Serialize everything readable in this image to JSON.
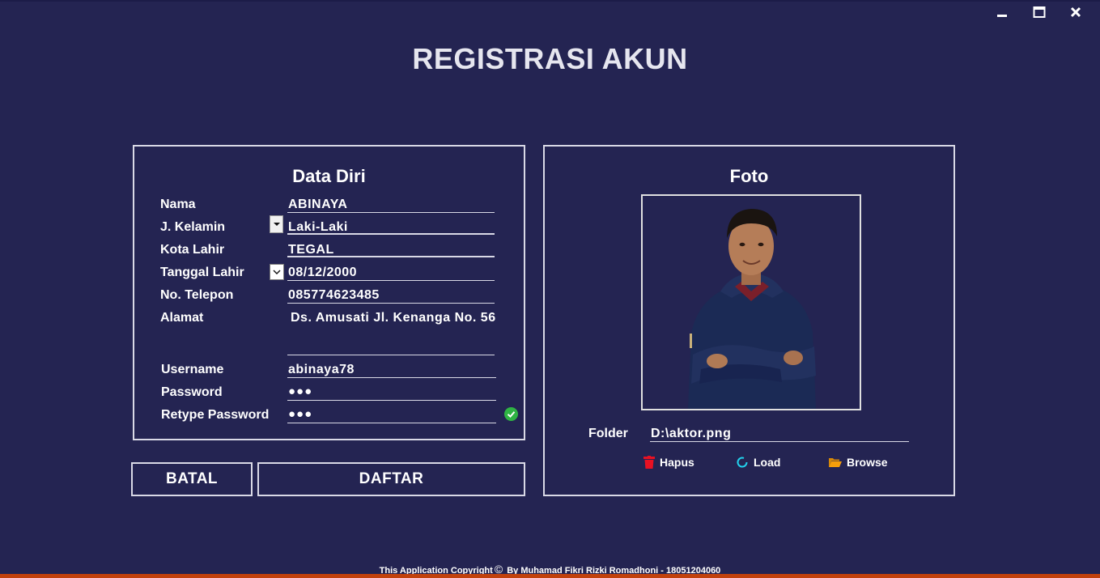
{
  "window": {
    "minimize_icon": "minimize-icon",
    "maximize_icon": "maximize-icon",
    "close_icon": "close-icon"
  },
  "title": "REGISTRASI AKUN",
  "data_diri": {
    "heading": "Data Diri",
    "fields": {
      "nama": {
        "label": "Nama",
        "value": "ABINAYA"
      },
      "kelamin": {
        "label": "J. Kelamin",
        "value": "Laki-Laki"
      },
      "kota_lahir": {
        "label": "Kota Lahir",
        "value": "TEGAL"
      },
      "tanggal_lahir": {
        "label": "Tanggal Lahir",
        "value": "08/12/2000"
      },
      "telepon": {
        "label": "No. Telepon",
        "value": "085774623485"
      },
      "alamat": {
        "label": "Alamat",
        "value": "Ds. Amusati Jl. Kenanga No. 56"
      },
      "username": {
        "label": "Username",
        "value": "abinaya78"
      },
      "password": {
        "label": "Password",
        "value": "●●●"
      },
      "retype": {
        "label": "Retype Password",
        "value": "●●●"
      }
    }
  },
  "foto": {
    "heading": "Foto",
    "folder_label": "Folder",
    "folder_value": "D:\\aktor.png",
    "actions": {
      "hapus": "Hapus",
      "load": "Load",
      "browse": "Browse"
    }
  },
  "buttons": {
    "batal": "BATAL",
    "daftar": "DAFTAR"
  },
  "footer": {
    "pre": "This Application Copyright",
    "symbol": "©",
    "post": " By Muhamad Fikri Rizki Romadhoni - 18051204060"
  },
  "colors": {
    "background": "#242452",
    "border": "#d9d9e6",
    "check": "#2fb344",
    "hapus": "#e81123",
    "load": "#22d3ee",
    "browse": "#f59e0b",
    "accent_bar": "#c2410c"
  }
}
